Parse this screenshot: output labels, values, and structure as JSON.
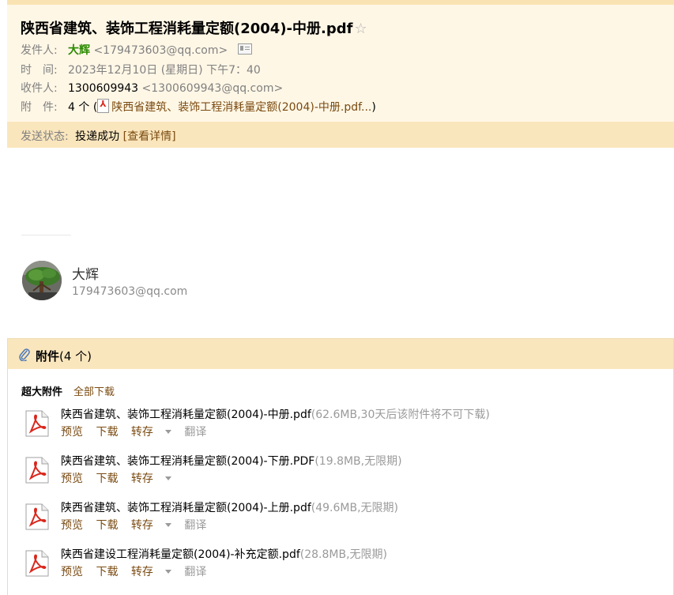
{
  "header": {
    "subject": "陕西省建筑、装饰工程消耗量定额(2004)-中册.pdf",
    "star": "☆",
    "from_label": "发件人:",
    "from_name": "大辉",
    "from_email": "<179473603@qq.com>",
    "time_label": "时　间:",
    "time_value": "2023年12月10日 (星期日) 下午7：40",
    "to_label": "收件人:",
    "to_name": "1300609943",
    "to_email": "<1300609943@qq.com>",
    "att_label": "附　件:",
    "att_count": "4 个",
    "att_open": "(",
    "att_summary": "陕西省建筑、装饰工程消耗量定额(2004)-中册.pdf...",
    "att_close": ")",
    "status_label": "发送状态:",
    "status_value": "投递成功",
    "status_link": "[查看详情]"
  },
  "sender": {
    "name": "大辉",
    "email": "179473603@qq.com"
  },
  "attachments": {
    "title": "附件",
    "count": "(4 个)",
    "section_label": "超大附件",
    "download_all": "全部下载",
    "items": [
      {
        "name": "陕西省建筑、装饰工程消耗量定额(2004)-中册.pdf",
        "info": "(62.6MB,30天后该附件将不可下载)",
        "preview": "预览",
        "download": "下载",
        "save": "转存",
        "translate": "翻译"
      },
      {
        "name": "陕西省建筑、装饰工程消耗量定额(2004)-下册.PDF",
        "info": "(19.8MB,无限期)",
        "preview": "预览",
        "download": "下载",
        "save": "转存",
        "translate": ""
      },
      {
        "name": "陕西省建筑、装饰工程消耗量定额(2004)-上册.pdf",
        "info": "(49.6MB,无限期)",
        "preview": "预览",
        "download": "下载",
        "save": "转存",
        "translate": "翻译"
      },
      {
        "name": "陕西省建设工程消耗量定额(2004)-补充定额.pdf",
        "info": "(28.8MB,无限期)",
        "preview": "预览",
        "download": "下载",
        "save": "转存",
        "translate": "翻译"
      }
    ]
  },
  "colors": {
    "header_bg": "#fff7e6",
    "bar_bg": "#fae6bd",
    "link_brown": "#7a4a10",
    "sender_green": "#2a8a00",
    "pdf_red": "#d9271c"
  }
}
